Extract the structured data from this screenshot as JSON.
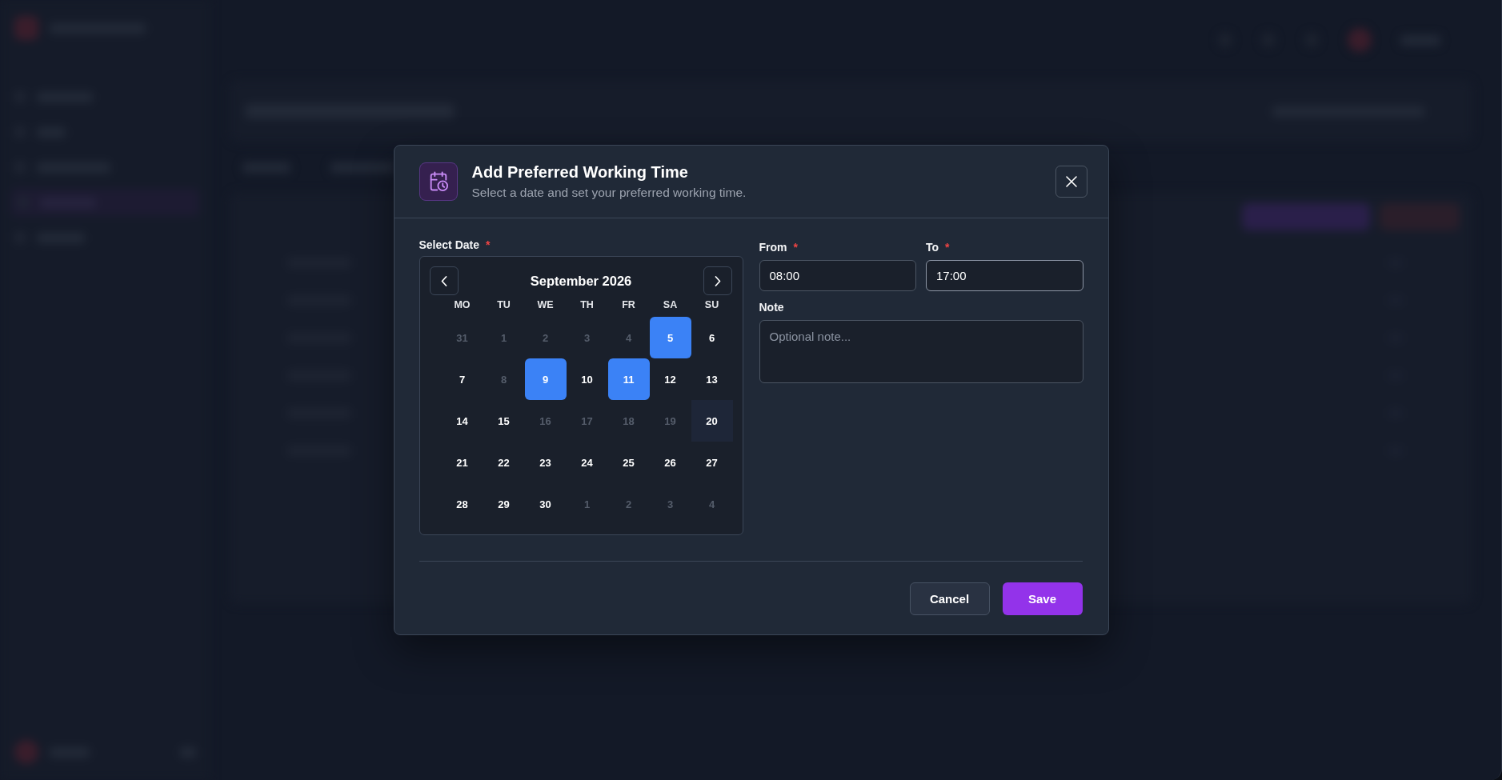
{
  "dialog": {
    "title": "Add Preferred Working Time",
    "subtitle": "Select a date and set your preferred working time."
  },
  "date_field": {
    "label": "Select Date",
    "required_mark": "*",
    "calendar": {
      "month": "September 2026",
      "weekdays": [
        "MO",
        "TU",
        "WE",
        "TH",
        "FR",
        "SA",
        "SU"
      ],
      "days": [
        {
          "label": "31",
          "selected": false,
          "disabled": true,
          "today": false
        },
        {
          "label": "1",
          "selected": false,
          "disabled": true,
          "today": false
        },
        {
          "label": "2",
          "selected": false,
          "disabled": true,
          "today": false
        },
        {
          "label": "3",
          "selected": false,
          "disabled": true,
          "today": false
        },
        {
          "label": "4",
          "selected": false,
          "disabled": true,
          "today": false
        },
        {
          "label": "5",
          "selected": true,
          "disabled": false,
          "today": false
        },
        {
          "label": "6",
          "selected": false,
          "disabled": false,
          "today": false
        },
        {
          "label": "7",
          "selected": false,
          "disabled": false,
          "today": false
        },
        {
          "label": "8",
          "selected": false,
          "disabled": true,
          "today": false
        },
        {
          "label": "9",
          "selected": true,
          "disabled": false,
          "today": false
        },
        {
          "label": "10",
          "selected": false,
          "disabled": false,
          "today": false
        },
        {
          "label": "11",
          "selected": true,
          "disabled": false,
          "today": false
        },
        {
          "label": "12",
          "selected": false,
          "disabled": false,
          "today": false
        },
        {
          "label": "13",
          "selected": false,
          "disabled": false,
          "today": false
        },
        {
          "label": "14",
          "selected": false,
          "disabled": false,
          "today": false
        },
        {
          "label": "15",
          "selected": false,
          "disabled": false,
          "today": false
        },
        {
          "label": "16",
          "selected": false,
          "disabled": true,
          "today": false
        },
        {
          "label": "17",
          "selected": false,
          "disabled": true,
          "today": false
        },
        {
          "label": "18",
          "selected": false,
          "disabled": true,
          "today": false
        },
        {
          "label": "19",
          "selected": false,
          "disabled": true,
          "today": false
        },
        {
          "label": "20",
          "selected": false,
          "disabled": false,
          "today": true
        },
        {
          "label": "21",
          "selected": false,
          "disabled": false,
          "today": false
        },
        {
          "label": "22",
          "selected": false,
          "disabled": false,
          "today": false
        },
        {
          "label": "23",
          "selected": false,
          "disabled": false,
          "today": false
        },
        {
          "label": "24",
          "selected": false,
          "disabled": false,
          "today": false
        },
        {
          "label": "25",
          "selected": false,
          "disabled": false,
          "today": false
        },
        {
          "label": "26",
          "selected": false,
          "disabled": false,
          "today": false
        },
        {
          "label": "27",
          "selected": false,
          "disabled": false,
          "today": false
        },
        {
          "label": "28",
          "selected": false,
          "disabled": false,
          "today": false
        },
        {
          "label": "29",
          "selected": false,
          "disabled": false,
          "today": false
        },
        {
          "label": "30",
          "selected": false,
          "disabled": false,
          "today": false
        },
        {
          "label": "1",
          "selected": false,
          "disabled": true,
          "today": false
        },
        {
          "label": "2",
          "selected": false,
          "disabled": true,
          "today": false
        },
        {
          "label": "3",
          "selected": false,
          "disabled": true,
          "today": false
        },
        {
          "label": "4",
          "selected": false,
          "disabled": true,
          "today": false
        }
      ]
    }
  },
  "time_fields": [
    {
      "label": "From",
      "required_mark": "*",
      "value": "08:00",
      "focused": false
    },
    {
      "label": "To",
      "required_mark": "*",
      "value": "17:00",
      "focused": true
    }
  ],
  "note_field": {
    "label": "Note",
    "placeholder": "Optional note..."
  },
  "buttons": [
    {
      "label": "Cancel",
      "kind": "secondary"
    },
    {
      "label": "Save",
      "kind": "primary"
    }
  ]
}
